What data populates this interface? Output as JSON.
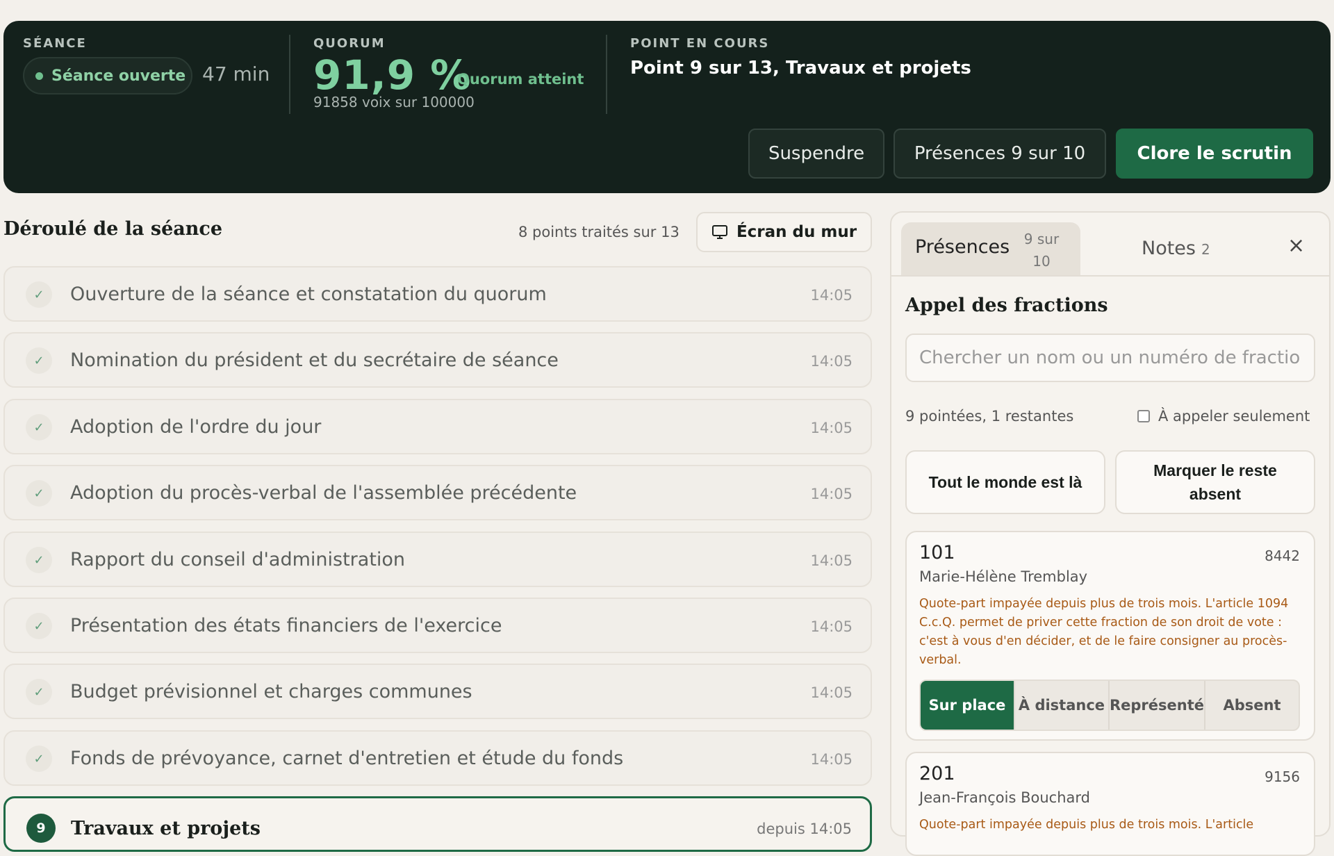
{
  "header": {
    "seance_label": "SÉANCE",
    "seance_status": "Séance ouverte",
    "duration": "47 min",
    "quorum_label": "QUORUM",
    "quorum_value": "91,9 %",
    "quorum_status": "Quorum atteint",
    "quorum_votes": "91858 voix sur 100000",
    "point_label": "POINT EN COURS",
    "point_current": "Point 9 sur 13, Travaux et projets",
    "buttons": {
      "suspend": "Suspendre",
      "presences": "Présences 9 sur 10",
      "close_vote": "Clore le scrutin"
    }
  },
  "agenda": {
    "title": "Déroulé de la séance",
    "progress": "8 points traités sur 13",
    "wall_screen": "Écran du mur",
    "items": [
      {
        "title": "Ouverture de la séance et constatation du quorum",
        "time": "14:05"
      },
      {
        "title": "Nomination du président et du secrétaire de séance",
        "time": "14:05"
      },
      {
        "title": "Adoption de l'ordre du jour",
        "time": "14:05"
      },
      {
        "title": "Adoption du procès-verbal de l'assemblée précédente",
        "time": "14:05"
      },
      {
        "title": "Rapport du conseil d'administration",
        "time": "14:05"
      },
      {
        "title": "Présentation des états financiers de l'exercice",
        "time": "14:05"
      },
      {
        "title": "Budget prévisionnel et charges communes",
        "time": "14:05"
      },
      {
        "title": "Fonds de prévoyance, carnet d'entretien et étude du fonds",
        "time": "14:05"
      }
    ],
    "current": {
      "number": "9",
      "title": "Travaux et projets",
      "time": "depuis 14:05"
    }
  },
  "panel": {
    "tab_presences": "Présences",
    "tab_presences_count": "9 sur 10",
    "tab_notes": "Notes",
    "tab_notes_count": "2",
    "close": "×",
    "title": "Appel des fractions",
    "search_placeholder": "Chercher un nom ou un numéro de fraction",
    "tally": "9 pointées, 1 restantes",
    "only_to_call": "À appeler seulement",
    "all_present": "Tout le monde est là",
    "mark_rest_absent": "Marquer le reste absent",
    "status_options": [
      "Sur place",
      "À distance",
      "Représenté",
      "Absent"
    ],
    "fractions": [
      {
        "number": "101",
        "share": "8442",
        "owner": "Marie-Hélène Tremblay",
        "warning": "Quote-part impayée depuis plus de trois mois. L'article 1094 C.c.Q. permet de priver cette fraction de son droit de vote : c'est à vous d'en décider, et de le faire consigner au procès-verbal.",
        "status": "Sur place"
      },
      {
        "number": "201",
        "share": "9156",
        "owner": "Jean-François Bouchard",
        "warning": "Quote-part impayée depuis plus de trois mois. L'article"
      }
    ]
  },
  "colors": {
    "header_bg": "#14211c",
    "accent_green": "#1e6a45",
    "quorum_green": "#7fd0a0",
    "warning_orange": "#a85a16",
    "page_bg": "#f3f0eb"
  }
}
